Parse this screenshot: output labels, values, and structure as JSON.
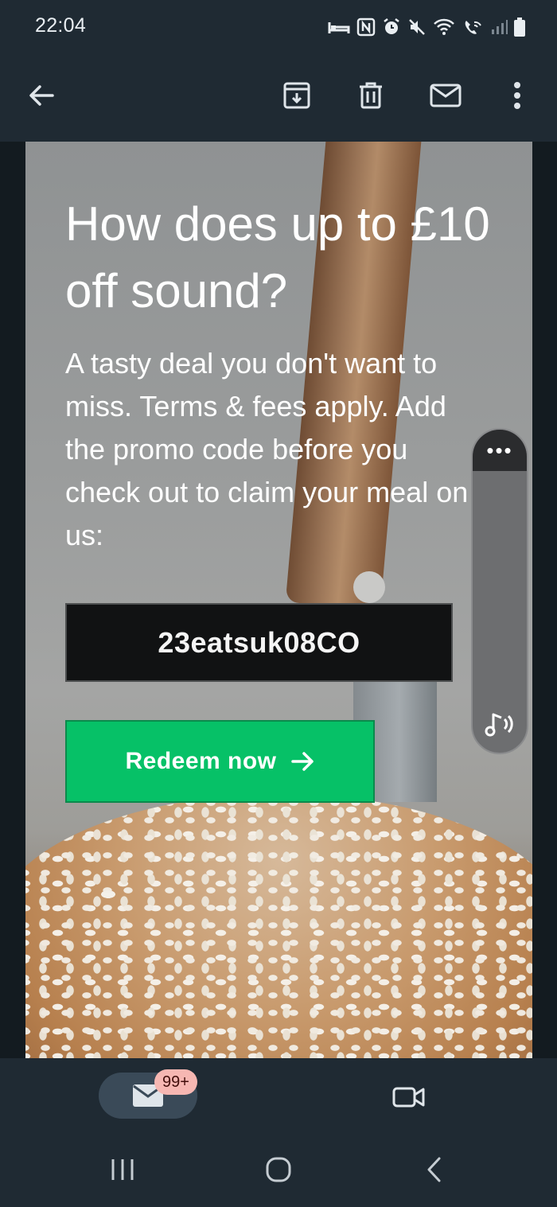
{
  "status_bar": {
    "time": "22:04",
    "icons": [
      "bed-icon",
      "nfc-icon",
      "alarm-icon",
      "mute-icon",
      "wifi-icon",
      "wifi-call-icon",
      "signal-icon",
      "battery-icon"
    ]
  },
  "app_bar": {
    "icons": [
      "back-arrow-icon",
      "archive-icon",
      "delete-icon",
      "mark-unread-icon",
      "more-vert-icon"
    ]
  },
  "email": {
    "headline": "How does up to £10 off sound?",
    "body": "A tasty deal you don't want to miss. Terms & fees apply. Add the promo code before you check out to claim your meal on us:",
    "promo_code": "23eatsuk08CO",
    "cta_label": "Redeem now",
    "cta_color": "#06c167"
  },
  "side_panel": {
    "more": "•••"
  },
  "bottom_nav": {
    "mail_badge": "99+",
    "icons": [
      "mail-icon",
      "video-icon"
    ]
  },
  "system_nav": {
    "icons": [
      "recents-icon",
      "home-icon",
      "back-icon"
    ]
  }
}
